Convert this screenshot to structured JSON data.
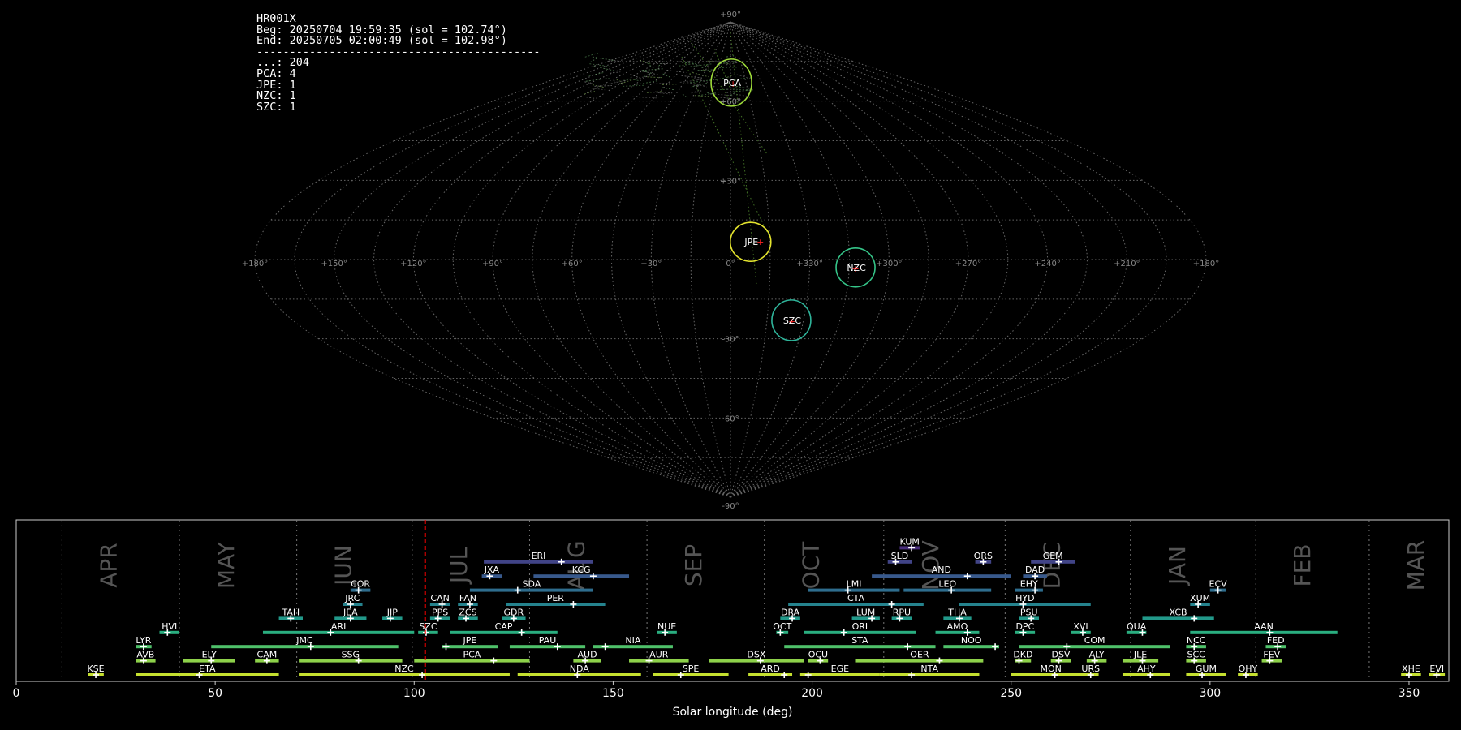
{
  "stats": {
    "lines": [
      "HR001X",
      "Beg: 20250704 19:59:35 (sol = 102.74°)",
      "End: 20250705 02:00:49 (sol = 102.98°)",
      "-------------------------------------------",
      "...: 204",
      "PCA: 4",
      "JPE: 1",
      "NZC: 1",
      "SZC: 1"
    ]
  },
  "chart_data": [
    {
      "type": "scatter",
      "projection": "sinusoidal",
      "grid": true,
      "lon_tick_labels": [
        "+180°",
        "+150°",
        "+120°",
        "+90°",
        "+60°",
        "+30°",
        "0°",
        "+330°",
        "+300°",
        "+270°",
        "+240°",
        "+210°",
        "+180°"
      ],
      "lat_tick_labels": [
        "+90°",
        "+60°",
        "+30°",
        "-30°",
        "-60°",
        "-90°"
      ],
      "radiants": [
        {
          "code": "PCA",
          "ra": 356,
          "dec": 67,
          "count": 4,
          "color": "#9fdd3a"
        },
        {
          "code": "JPE",
          "ra": 348,
          "dec": 7,
          "count": 1,
          "color": "#e3e32e"
        },
        {
          "code": "NZC",
          "ra": 312,
          "dec": -3,
          "count": 1,
          "color": "#35c488"
        },
        {
          "code": "SZC",
          "ra": 334,
          "dec": -23,
          "count": 1,
          "color": "#2fb49a"
        }
      ],
      "sporadic_count": 204
    },
    {
      "type": "timeline",
      "xlabel": "Solar longitude (deg)",
      "xlim": [
        0,
        360
      ],
      "x_ticks": [
        0,
        50,
        100,
        150,
        200,
        250,
        300,
        350
      ],
      "current_sol": 102.74,
      "months": [
        {
          "name": "APR",
          "sol": 11.5
        },
        {
          "name": "MAY",
          "sol": 41
        },
        {
          "name": "JUN",
          "sol": 70.5
        },
        {
          "name": "JUL",
          "sol": 99.5
        },
        {
          "name": "AUG",
          "sol": 129
        },
        {
          "name": "SEP",
          "sol": 158.5
        },
        {
          "name": "OCT",
          "sol": 188
        },
        {
          "name": "NOV",
          "sol": 218
        },
        {
          "name": "DEC",
          "sol": 248.5
        },
        {
          "name": "JAN",
          "sol": 280
        },
        {
          "name": "FEB",
          "sol": 311.5
        },
        {
          "name": "MAR",
          "sol": 340
        }
      ],
      "showers": [
        {
          "code": "KUM",
          "start": 222,
          "end": 227,
          "peak": 225,
          "row": 10
        },
        {
          "code": "ERI",
          "start": 117.5,
          "end": 145,
          "peak": 137,
          "row": 9
        },
        {
          "code": "SLD",
          "start": 219,
          "end": 225,
          "peak": 221,
          "row": 9
        },
        {
          "code": "ORS",
          "start": 241,
          "end": 245,
          "peak": 243,
          "row": 9
        },
        {
          "code": "GEM",
          "start": 255,
          "end": 266,
          "peak": 262,
          "row": 9
        },
        {
          "code": "JXA",
          "start": 117,
          "end": 122,
          "peak": 119,
          "row": 8
        },
        {
          "code": "KCG",
          "start": 130,
          "end": 154,
          "peak": 145,
          "row": 8
        },
        {
          "code": "AND",
          "start": 215,
          "end": 250,
          "peak": 239,
          "row": 8
        },
        {
          "code": "DAD",
          "start": 253,
          "end": 259,
          "peak": 256,
          "row": 8
        },
        {
          "code": "COR",
          "start": 84,
          "end": 89,
          "peak": 86,
          "row": 7
        },
        {
          "code": "SDA",
          "start": 114,
          "end": 145,
          "peak": 126,
          "row": 7
        },
        {
          "code": "LMI",
          "start": 199,
          "end": 222,
          "peak": 209,
          "row": 7
        },
        {
          "code": "LEO",
          "start": 223,
          "end": 245,
          "peak": 235,
          "row": 7
        },
        {
          "code": "EHY",
          "start": 251,
          "end": 258,
          "peak": 256,
          "row": 7
        },
        {
          "code": "ECV",
          "start": 300,
          "end": 304,
          "peak": 302,
          "row": 7
        },
        {
          "code": "JRC",
          "start": 82,
          "end": 87,
          "peak": 84,
          "row": 6
        },
        {
          "code": "CAN",
          "start": 104,
          "end": 109,
          "peak": 107,
          "row": 6
        },
        {
          "code": "FAN",
          "start": 111,
          "end": 116,
          "peak": 114,
          "row": 6
        },
        {
          "code": "PER",
          "start": 123,
          "end": 148,
          "peak": 140,
          "row": 6
        },
        {
          "code": "CTA",
          "start": 194,
          "end": 228,
          "peak": 220,
          "row": 6
        },
        {
          "code": "HYD",
          "start": 237,
          "end": 270,
          "peak": 253,
          "row": 6
        },
        {
          "code": "XUM",
          "start": 295,
          "end": 300,
          "peak": 297,
          "row": 6
        },
        {
          "code": "TAH",
          "start": 66,
          "end": 72,
          "peak": 69,
          "row": 5
        },
        {
          "code": "JEA",
          "start": 80,
          "end": 88,
          "peak": 84,
          "row": 5
        },
        {
          "code": "JIP",
          "start": 92,
          "end": 97,
          "peak": 94,
          "row": 5
        },
        {
          "code": "PPS",
          "start": 104,
          "end": 109,
          "peak": 106,
          "row": 5
        },
        {
          "code": "ZCS",
          "start": 111,
          "end": 116,
          "peak": 113,
          "row": 5
        },
        {
          "code": "GDR",
          "start": 122,
          "end": 128,
          "peak": 125,
          "row": 5
        },
        {
          "code": "DRA",
          "start": 192,
          "end": 197,
          "peak": 195,
          "row": 5
        },
        {
          "code": "LUM",
          "start": 210,
          "end": 217,
          "peak": 215,
          "row": 5
        },
        {
          "code": "RPU",
          "start": 220,
          "end": 225,
          "peak": 222,
          "row": 5
        },
        {
          "code": "THA",
          "start": 233,
          "end": 240,
          "peak": 237,
          "row": 5
        },
        {
          "code": "PSU",
          "start": 252,
          "end": 257,
          "peak": 255,
          "row": 5
        },
        {
          "code": "XCB",
          "start": 283,
          "end": 301,
          "peak": 296,
          "row": 5
        },
        {
          "code": "HVI",
          "start": 36,
          "end": 41,
          "peak": 38,
          "row": 4
        },
        {
          "code": "ARI",
          "start": 62,
          "end": 100,
          "peak": 79,
          "row": 4
        },
        {
          "code": "SZC",
          "start": 101,
          "end": 106,
          "peak": 103,
          "row": 4
        },
        {
          "code": "CAP",
          "start": 109,
          "end": 136,
          "peak": 127,
          "row": 4
        },
        {
          "code": "NUE",
          "start": 161,
          "end": 166,
          "peak": 163,
          "row": 4
        },
        {
          "code": "OCT",
          "start": 191,
          "end": 194,
          "peak": 192,
          "row": 4
        },
        {
          "code": "ORI",
          "start": 198,
          "end": 226,
          "peak": 208,
          "row": 4
        },
        {
          "code": "AMO",
          "start": 231,
          "end": 242,
          "peak": 239,
          "row": 4
        },
        {
          "code": "DPC",
          "start": 251,
          "end": 256,
          "peak": 253,
          "row": 4
        },
        {
          "code": "XVI",
          "start": 265,
          "end": 270,
          "peak": 268,
          "row": 4
        },
        {
          "code": "QUA",
          "start": 279,
          "end": 284,
          "peak": 283,
          "row": 4
        },
        {
          "code": "AAN",
          "start": 295,
          "end": 332,
          "peak": 315,
          "row": 4
        },
        {
          "code": "LYR",
          "start": 30,
          "end": 34,
          "peak": 32,
          "row": 3
        },
        {
          "code": "JMC",
          "start": 49,
          "end": 96,
          "peak": 74,
          "row": 3
        },
        {
          "code": "JPE",
          "start": 107,
          "end": 121,
          "peak": 108,
          "row": 3
        },
        {
          "code": "PAU",
          "start": 124,
          "end": 143,
          "peak": 136,
          "row": 3
        },
        {
          "code": "NIA",
          "start": 145,
          "end": 165,
          "peak": 148,
          "row": 3
        },
        {
          "code": "STA",
          "start": 193,
          "end": 231,
          "peak": 224,
          "row": 3
        },
        {
          "code": "NOO",
          "start": 233,
          "end": 247,
          "peak": 246,
          "row": 3
        },
        {
          "code": "COM",
          "start": 252,
          "end": 290,
          "peak": 264,
          "row": 3
        },
        {
          "code": "NCC",
          "start": 294,
          "end": 299,
          "peak": 296,
          "row": 3
        },
        {
          "code": "FED",
          "start": 314,
          "end": 319,
          "peak": 317,
          "row": 3
        },
        {
          "code": "AVB",
          "start": 30,
          "end": 35,
          "peak": 32,
          "row": 2
        },
        {
          "code": "ELY",
          "start": 42,
          "end": 55,
          "peak": 49,
          "row": 2
        },
        {
          "code": "CAM",
          "start": 60,
          "end": 66,
          "peak": 63,
          "row": 2
        },
        {
          "code": "SSG",
          "start": 71,
          "end": 97,
          "peak": 86,
          "row": 2
        },
        {
          "code": "PCA",
          "start": 100,
          "end": 129,
          "peak": 120,
          "row": 2
        },
        {
          "code": "AUD",
          "start": 140,
          "end": 147,
          "peak": 143,
          "row": 2
        },
        {
          "code": "AUR",
          "start": 154,
          "end": 169,
          "peak": 159,
          "row": 2
        },
        {
          "code": "DSX",
          "start": 174,
          "end": 198,
          "peak": 187,
          "row": 2
        },
        {
          "code": "OCU",
          "start": 199,
          "end": 204,
          "peak": 202,
          "row": 2
        },
        {
          "code": "OER",
          "start": 211,
          "end": 243,
          "peak": 232,
          "row": 2
        },
        {
          "code": "DKD",
          "start": 251,
          "end": 255,
          "peak": 252,
          "row": 2
        },
        {
          "code": "DSV",
          "start": 260,
          "end": 265,
          "peak": 262,
          "row": 2
        },
        {
          "code": "ALY",
          "start": 269,
          "end": 274,
          "peak": 271,
          "row": 2
        },
        {
          "code": "JLE",
          "start": 278,
          "end": 287,
          "peak": 283,
          "row": 2
        },
        {
          "code": "SCC",
          "start": 294,
          "end": 299,
          "peak": 296,
          "row": 2
        },
        {
          "code": "FEV",
          "start": 313,
          "end": 318,
          "peak": 315,
          "row": 2
        },
        {
          "code": "KSE",
          "start": 18,
          "end": 22,
          "peak": 20,
          "row": 1
        },
        {
          "code": "ETA",
          "start": 30,
          "end": 66,
          "peak": 46,
          "row": 1
        },
        {
          "code": "NZC",
          "start": 71,
          "end": 124,
          "peak": 102,
          "row": 1
        },
        {
          "code": "NDA",
          "start": 126,
          "end": 157,
          "peak": 141,
          "row": 1
        },
        {
          "code": "SPE",
          "start": 160,
          "end": 179,
          "peak": 167,
          "row": 1
        },
        {
          "code": "ARD",
          "start": 184,
          "end": 195,
          "peak": 193,
          "row": 1
        },
        {
          "code": "EGE",
          "start": 197,
          "end": 217,
          "peak": 199,
          "row": 1
        },
        {
          "code": "NTA",
          "start": 217,
          "end": 242,
          "peak": 225,
          "row": 1
        },
        {
          "code": "MON",
          "start": 250,
          "end": 270,
          "peak": 261,
          "row": 1
        },
        {
          "code": "URS",
          "start": 268,
          "end": 272,
          "peak": 270,
          "row": 1
        },
        {
          "code": "AHY",
          "start": 278,
          "end": 290,
          "peak": 285,
          "row": 1
        },
        {
          "code": "GUM",
          "start": 294,
          "end": 304,
          "peak": 298,
          "row": 1
        },
        {
          "code": "OHY",
          "start": 307,
          "end": 312,
          "peak": 309,
          "row": 1
        },
        {
          "code": "XHE",
          "start": 348,
          "end": 353,
          "peak": 350,
          "row": 1
        },
        {
          "code": "EVI",
          "start": 355,
          "end": 359,
          "peak": 357,
          "row": 1
        }
      ]
    }
  ]
}
